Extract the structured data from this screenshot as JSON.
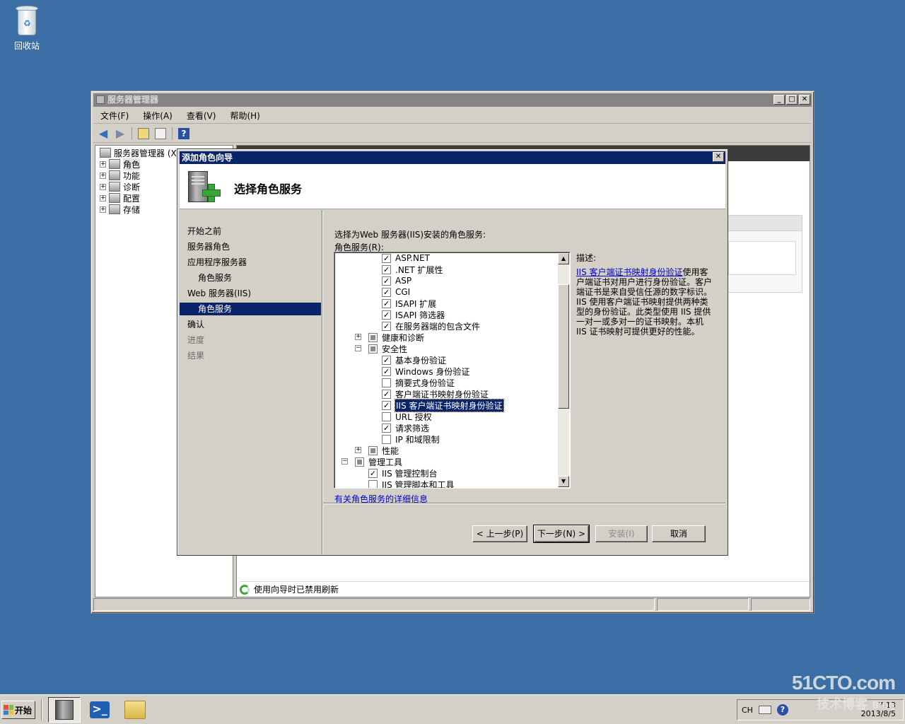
{
  "desktop": {
    "recycle_bin_label": "回收站"
  },
  "window": {
    "title": "服务器管理器",
    "menu": [
      "文件(F)",
      "操作(A)",
      "查看(V)",
      "帮助(H)"
    ],
    "tree": [
      {
        "label": "服务器管理器 (XI-IIS...)",
        "expand": ""
      },
      {
        "label": "角色",
        "expand": "+"
      },
      {
        "label": "功能",
        "expand": "+"
      },
      {
        "label": "诊断",
        "expand": "+"
      },
      {
        "label": "配置",
        "expand": "+"
      },
      {
        "label": "存储",
        "expand": "+"
      }
    ],
    "status_refresh": "使用向导时已禁用刷新"
  },
  "dialog": {
    "title": "添加角色向导",
    "header": "选择角色服务",
    "nav": [
      {
        "label": "开始之前",
        "state": "normal"
      },
      {
        "label": "服务器角色",
        "state": "normal"
      },
      {
        "label": "应用程序服务器",
        "state": "normal"
      },
      {
        "label": "角色服务",
        "state": "sub"
      },
      {
        "label": "Web 服务器(IIS)",
        "state": "normal"
      },
      {
        "label": "角色服务",
        "state": "selected"
      },
      {
        "label": "确认",
        "state": "normal"
      },
      {
        "label": "进度",
        "state": "dim"
      },
      {
        "label": "结果",
        "state": "dim"
      }
    ],
    "instruction": "选择为Web 服务器(IIS)安装的角色服务:",
    "list_label": "角色服务(R):",
    "services": [
      {
        "label": "ASP.NET",
        "checked": true,
        "level": 2
      },
      {
        "label": ".NET 扩展性",
        "checked": true,
        "level": 2
      },
      {
        "label": "ASP",
        "checked": true,
        "level": 2
      },
      {
        "label": "CGI",
        "checked": true,
        "level": 2
      },
      {
        "label": "ISAPI 扩展",
        "checked": true,
        "level": 2
      },
      {
        "label": "ISAPI 筛选器",
        "checked": true,
        "level": 2
      },
      {
        "label": "在服务器端的包含文件",
        "checked": true,
        "level": 2
      },
      {
        "label": "健康和诊断",
        "checked": "partial",
        "level": 1,
        "expand": "+"
      },
      {
        "label": "安全性",
        "checked": "partial",
        "level": 1,
        "expand": "−"
      },
      {
        "label": "基本身份验证",
        "checked": true,
        "level": 2
      },
      {
        "label": "Windows 身份验证",
        "checked": true,
        "level": 2
      },
      {
        "label": "摘要式身份验证",
        "checked": false,
        "level": 2
      },
      {
        "label": "客户端证书映射身份验证",
        "checked": true,
        "level": 2
      },
      {
        "label": "IIS 客户端证书映射身份验证",
        "checked": true,
        "level": 2,
        "selected": true
      },
      {
        "label": "URL 授权",
        "checked": false,
        "level": 2
      },
      {
        "label": "请求筛选",
        "checked": true,
        "level": 2
      },
      {
        "label": "IP 和域限制",
        "checked": false,
        "level": 2
      },
      {
        "label": "性能",
        "checked": "partial",
        "level": 1,
        "expand": "+"
      },
      {
        "label": "管理工具",
        "checked": "partial",
        "level": 0,
        "expand": "−"
      },
      {
        "label": "IIS 管理控制台",
        "checked": true,
        "level": 1
      },
      {
        "label": "IIS 管理脚本和工具",
        "checked": false,
        "level": 1
      }
    ],
    "description_label": "描述:",
    "description_link": "IIS 客户端证书映射身份验证",
    "description_text": "使用客户端证书对用户进行身份验证。客户端证书是来自受信任源的数字标识。IIS 使用客户端证书映射提供两种类型的身份验证。此类型使用 IIS 提供一对一或多对一的证书映射。本机 IIS 证书映射可提供更好的性能。",
    "more_info_link": "有关角色服务的详细信息",
    "buttons": {
      "back": "< 上一步(P)",
      "next": "下一步(N) >",
      "install": "安装(I)",
      "cancel": "取消"
    }
  },
  "taskbar": {
    "start_label": "开始",
    "lang": "CH",
    "time": "7:13",
    "date": "2013/8/5"
  },
  "watermark": {
    "line1": "51CTO.com",
    "line2": "技术博客",
    "line3": "Blog"
  }
}
